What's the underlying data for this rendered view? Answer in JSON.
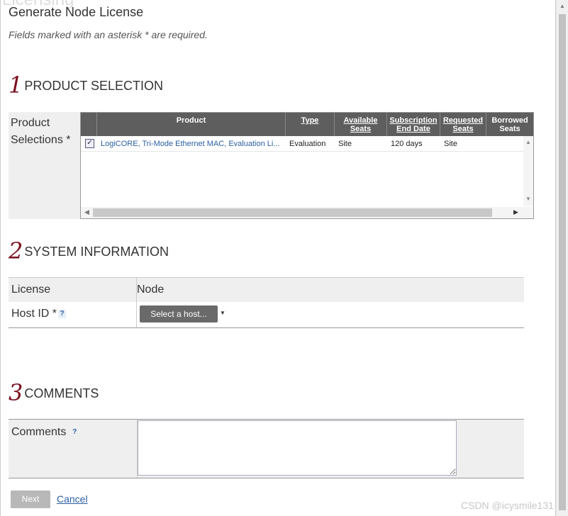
{
  "dialog": {
    "title": "Generate Node License",
    "subtitle": "Fields marked with an asterisk * are required.",
    "ghost_heading": "Licensing"
  },
  "sections": {
    "product": {
      "num": "1",
      "label": "PRODUCT SELECTION"
    },
    "system": {
      "num": "2",
      "label": "SYSTEM INFORMATION"
    },
    "comments": {
      "num": "3",
      "label": "COMMENTS"
    }
  },
  "product_selection": {
    "label_line1": "Product",
    "label_line2": "Selections *",
    "columns": [
      {
        "label": "Product"
      },
      {
        "label": "Type"
      },
      {
        "label": "Available Seats"
      },
      {
        "label": "Subscription End Date"
      },
      {
        "label": "Requested Seats"
      },
      {
        "label": "Borrowed Seats"
      }
    ],
    "rows": [
      {
        "checked": "✓",
        "product": "LogiCORE, Tri-Mode Ethernet MAC, Evaluation Li...",
        "type": "Evaluation",
        "available": "Site",
        "subscription": "120 days",
        "requested": "Site",
        "borrowed": ""
      }
    ]
  },
  "system_info": {
    "col_license": "License",
    "col_node": "Node",
    "host_label": "Host ID *",
    "help": "?",
    "host_button": "Select a host..."
  },
  "comments": {
    "label": "Comments",
    "help": "?",
    "value": ""
  },
  "actions": {
    "next": "Next",
    "cancel": "Cancel"
  },
  "watermark": "CSDN @icysmile131",
  "colors": {
    "section_number": "#7a1020",
    "header_bg": "#5e5e5e",
    "link": "#2b5fa4"
  }
}
